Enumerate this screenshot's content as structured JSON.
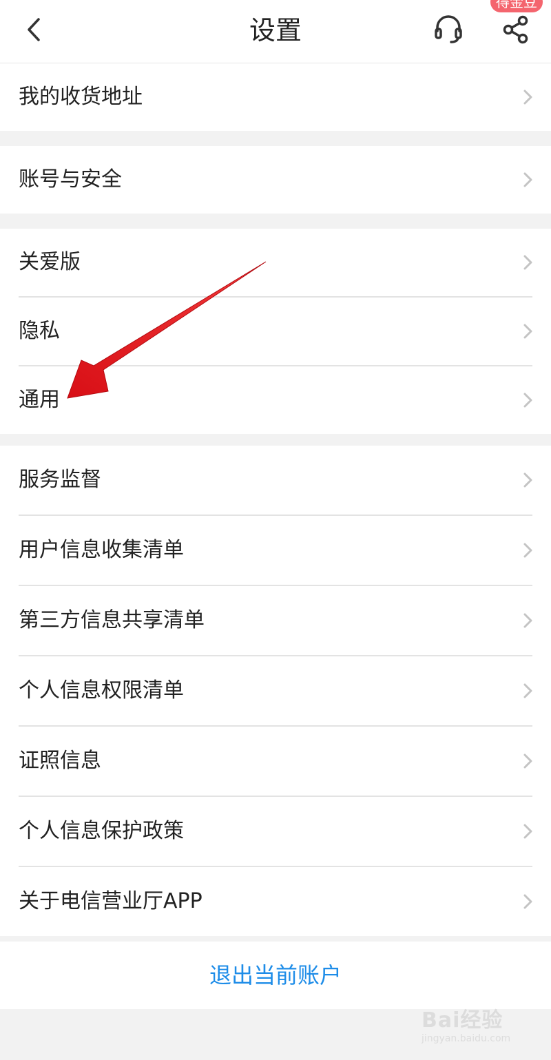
{
  "header": {
    "title": "设置",
    "badge": "得金豆",
    "icons": {
      "back": "chevron-left-icon",
      "service": "headset-icon",
      "share": "share-icon"
    }
  },
  "groups": [
    {
      "items": [
        {
          "label": "我的收货地址"
        }
      ]
    },
    {
      "items": [
        {
          "label": "账号与安全"
        }
      ]
    },
    {
      "items": [
        {
          "label": "关爱版"
        },
        {
          "label": "隐私"
        },
        {
          "label": "通用"
        }
      ]
    },
    {
      "items": [
        {
          "label": "服务监督"
        },
        {
          "label": "用户信息收集清单"
        },
        {
          "label": "第三方信息共享清单"
        },
        {
          "label": "个人信息权限清单"
        },
        {
          "label": "证照信息"
        },
        {
          "label": "个人信息保护政策"
        },
        {
          "label": "关于电信营业厅APP"
        }
      ]
    }
  ],
  "logout": {
    "label": "退出当前账户"
  },
  "watermark": {
    "main": "Bai经验",
    "sub": "jingyan.baidu.com"
  },
  "colors": {
    "link": "#1d8ce8",
    "badge": "#f4656e",
    "annotation_arrow": "#e8141b"
  }
}
